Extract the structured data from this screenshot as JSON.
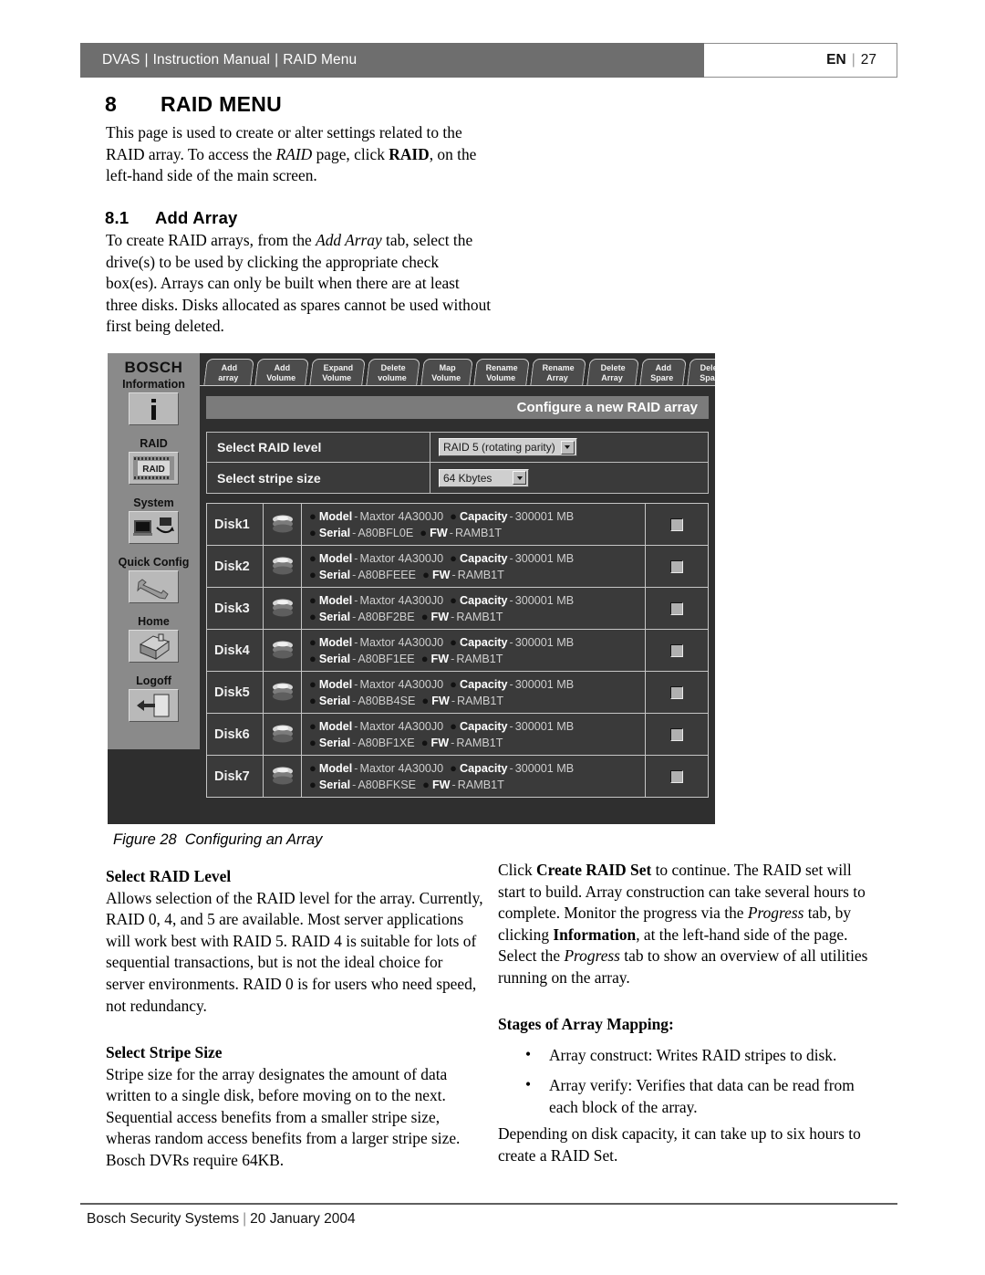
{
  "header": {
    "breadcrumb_1": "DVAS",
    "breadcrumb_2": "Instruction Manual",
    "breadcrumb_3": "RAID Menu",
    "separator": "|",
    "language": "EN",
    "page_number": "27",
    "bar_color": "#6e6e6e"
  },
  "chapter": {
    "number": "8",
    "title": "RAID MENU",
    "intro_1": "This page is used to create or alter settings related to the RAID array. To access the ",
    "intro_italic": "RAID",
    "intro_2": " page, click ",
    "intro_bold": "RAID",
    "intro_3": ", on the left-hand side of the main screen."
  },
  "section": {
    "number": "8.1",
    "title": "Add Array",
    "body_1": "To create RAID arrays, from the ",
    "body_italic": "Add Array",
    "body_2": " tab, select the drive(s) to be used by clicking the appropriate check box(es). Arrays can only be built when there are at least three disks. Disks allocated as spares cannot be used without first being deleted."
  },
  "screenshot": {
    "brand": "BOSCH",
    "nav": [
      {
        "label": "Information",
        "icon": "info-icon"
      },
      {
        "label": "RAID",
        "icon": "raid-icon"
      },
      {
        "label": "System",
        "icon": "system-icon"
      },
      {
        "label": "Quick Config",
        "icon": "wrench-icon"
      },
      {
        "label": "Home",
        "icon": "home-icon"
      },
      {
        "label": "Logoff",
        "icon": "logoff-icon"
      }
    ],
    "tabs": [
      {
        "line1": "Add",
        "line2": "array"
      },
      {
        "line1": "Add",
        "line2": "Volume"
      },
      {
        "line1": "Expand",
        "line2": "Volume"
      },
      {
        "line1": "Delete",
        "line2": "volume"
      },
      {
        "line1": "Map",
        "line2": "Volume"
      },
      {
        "line1": "Rename",
        "line2": "Volume"
      },
      {
        "line1": "Rename",
        "line2": "Array"
      },
      {
        "line1": "Delete",
        "line2": "Array"
      },
      {
        "line1": "Add",
        "line2": "Spare"
      },
      {
        "line1": "Delete",
        "line2": "Spare"
      }
    ],
    "panel_title": "Configure a new RAID array",
    "form": [
      {
        "label": "Select RAID level",
        "value": "RAID 5 (rotating parity)",
        "control": "dropdown"
      },
      {
        "label": "Select stripe size",
        "value": "64 Kbytes",
        "control": "dropdown"
      }
    ],
    "disk_labels": {
      "model": "Model",
      "capacity": "Capacity",
      "serial": "Serial",
      "fw": "FW",
      "dash": "-"
    },
    "disks": [
      {
        "name": "Disk1",
        "model": "Maxtor 4A300J0",
        "capacity": "300001 MB",
        "serial": "A80BFL0E",
        "fw": "RAMB1T",
        "checked": false
      },
      {
        "name": "Disk2",
        "model": "Maxtor 4A300J0",
        "capacity": "300001 MB",
        "serial": "A80BFEEE",
        "fw": "RAMB1T",
        "checked": false
      },
      {
        "name": "Disk3",
        "model": "Maxtor 4A300J0",
        "capacity": "300001 MB",
        "serial": "A80BF2BE",
        "fw": "RAMB1T",
        "checked": false
      },
      {
        "name": "Disk4",
        "model": "Maxtor 4A300J0",
        "capacity": "300001 MB",
        "serial": "A80BF1EE",
        "fw": "RAMB1T",
        "checked": false
      },
      {
        "name": "Disk5",
        "model": "Maxtor 4A300J0",
        "capacity": "300001 MB",
        "serial": "A80BB4SE",
        "fw": "RAMB1T",
        "checked": false
      },
      {
        "name": "Disk6",
        "model": "Maxtor 4A300J0",
        "capacity": "300001 MB",
        "serial": "A80BF1XE",
        "fw": "RAMB1T",
        "checked": false
      },
      {
        "name": "Disk7",
        "model": "Maxtor 4A300J0",
        "capacity": "300001 MB",
        "serial": "A80BFKSE",
        "fw": "RAMB1T",
        "checked": false
      }
    ]
  },
  "figure": {
    "number": "Figure 28",
    "caption": "Configuring an Array"
  },
  "left_column": {
    "h_raid_level": "Select RAID Level",
    "p_raid_level": "Allows selection of the RAID level for the array. Currently, RAID 0, 4, and 5 are available. Most server applications will work best with RAID 5. RAID 4 is suitable for lots of sequential transactions, but is not the ideal choice for server environments. RAID 0 is for users who need speed, not redundancy.",
    "h_stripe": "Select Stripe Size",
    "p_stripe": "Stripe size for the array designates the amount of data written to a single disk, before moving on to the next. Sequential access benefits from a smaller stripe size, wheras random access benefits from a larger stripe size. Bosch DVRs require 64KB."
  },
  "right_column": {
    "p1_a": "Click ",
    "p1_bold": "Create RAID Set",
    "p1_b": " to continue. The RAID set will start to build. Array construction can take several hours to complete. Monitor the progress via the ",
    "p1_italic1": "Progress",
    "p1_c": " tab, by clicking ",
    "p1_bold2": "Information",
    "p1_d": ", at the left-hand side of the page. Select the ",
    "p1_italic2": "Progress",
    "p1_e": " tab to show an overview of all utilities running on the array.",
    "h_stages": "Stages of Array Mapping:",
    "bullet_1": "Array construct: Writes RAID stripes to disk.",
    "bullet_2": "Array verify: Verifies that data can be read from each block of the array.",
    "p2": "Depending on disk capacity, it can take up to six hours to create a RAID Set."
  },
  "footer": {
    "company": "Bosch Security Systems",
    "separator": "|",
    "date": "20 January 2004"
  }
}
